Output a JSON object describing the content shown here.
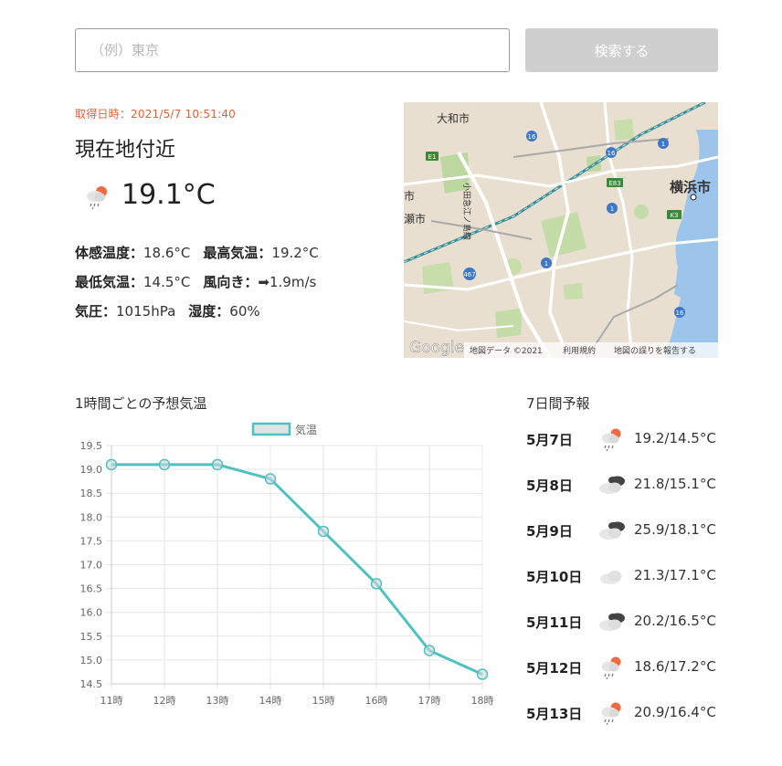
{
  "search": {
    "placeholder": "（例）東京",
    "button_label": "検索する"
  },
  "current": {
    "fetched_at": "取得日時：2021/5/7 10:51:40",
    "location": "現在地付近",
    "icon": "rain-sun-icon",
    "temperature": "19.1°C",
    "feels_like_label": "体感温度：",
    "feels_like_value": "18.6°C",
    "max_label": "最高気温：",
    "max_value": "19.2°C",
    "min_label": "最低気温：",
    "min_value": "14.5°C",
    "wind_label": "風向き：",
    "wind_arrow": "➡",
    "wind_value": "1.9m/s",
    "pressure_label": "気圧：",
    "pressure_value": "1015hPa",
    "humidity_label": "湿度：",
    "humidity_value": "60%"
  },
  "map": {
    "city_labels": [
      "大和市",
      "横浜市",
      "市",
      "瀬市",
      "小田急江ノ島線"
    ],
    "road_badges": [
      "16",
      "16",
      "1",
      "E1",
      "E83",
      "1",
      "K3",
      "1",
      "467",
      "16"
    ],
    "google_logo": "Google",
    "attribution": "地図データ ©2021",
    "terms": "利用規約",
    "report": "地図の誤りを報告する"
  },
  "hourly": {
    "title": "1時間ごとの予想気温"
  },
  "chart_data": {
    "type": "line",
    "title": "",
    "xlabel": "",
    "ylabel": "",
    "legend_position": "top",
    "grid": true,
    "categories": [
      "11時",
      "12時",
      "13時",
      "14時",
      "15時",
      "16時",
      "17時",
      "18時"
    ],
    "series": [
      {
        "name": "気温",
        "values": [
          19.1,
          19.1,
          19.1,
          18.8,
          17.7,
          16.6,
          15.2,
          14.7
        ],
        "color": "#4fc1c1"
      }
    ],
    "ylim": [
      14.5,
      19.5
    ],
    "yticks": [
      "19.5",
      "19.0",
      "18.5",
      "18.0",
      "17.5",
      "17.0",
      "16.5",
      "16.0",
      "15.5",
      "15.0",
      "14.5"
    ]
  },
  "weekly": {
    "title": "7日間予報",
    "days": [
      {
        "date": "5月7日",
        "icon": "rain-sun-icon",
        "temp": "19.2/14.5°C"
      },
      {
        "date": "5月8日",
        "icon": "cloudy-icon",
        "temp": "21.8/15.1°C"
      },
      {
        "date": "5月9日",
        "icon": "cloudy-icon",
        "temp": "25.9/18.1°C"
      },
      {
        "date": "5月10日",
        "icon": "cloud-icon",
        "temp": "21.3/17.1°C"
      },
      {
        "date": "5月11日",
        "icon": "cloudy-icon",
        "temp": "20.2/16.5°C"
      },
      {
        "date": "5月12日",
        "icon": "rain-sun-icon",
        "temp": "18.6/17.2°C"
      },
      {
        "date": "5月13日",
        "icon": "rain-sun-icon",
        "temp": "20.9/16.4°C"
      }
    ]
  },
  "colors": {
    "accent": "#e0623a",
    "series": "#4fc1c1",
    "button": "#cfcfcf"
  }
}
